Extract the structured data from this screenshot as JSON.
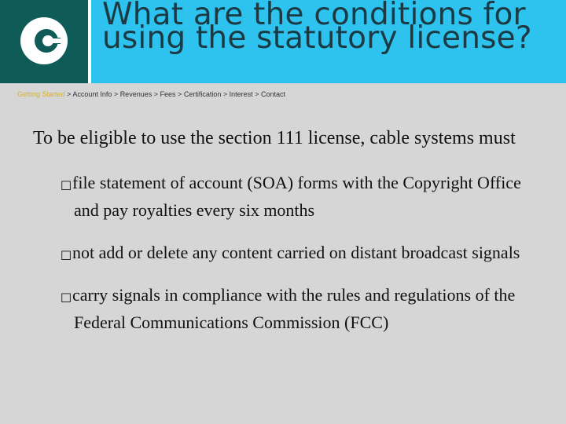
{
  "header": {
    "title": "What are the conditions for\nusing the statutory license?",
    "logo_icon": "copyright-office-logo-icon"
  },
  "breadcrumb": {
    "items": [
      "Getting Started",
      "Account Info",
      "Revenues",
      "Fees",
      "Certification",
      "Interest",
      "Contact"
    ],
    "separator": ">"
  },
  "content": {
    "lead": "To be eligible to use the section 111 license, cable systems must",
    "bullets": [
      "file statement of account (SOA) forms with the Copyright Office and pay royalties every six months",
      "not add or delete any content carried on distant broadcast signals",
      "carry signals in compliance with the rules and regulations of the Federal Communications Commission (FCC)"
    ],
    "bullet_glyph": "☐"
  },
  "colors": {
    "header_bg": "#2ec3ef",
    "logo_bg": "#0f5b58",
    "page_bg": "#d6d6d6",
    "breadcrumb_active": "#d9b22a"
  }
}
